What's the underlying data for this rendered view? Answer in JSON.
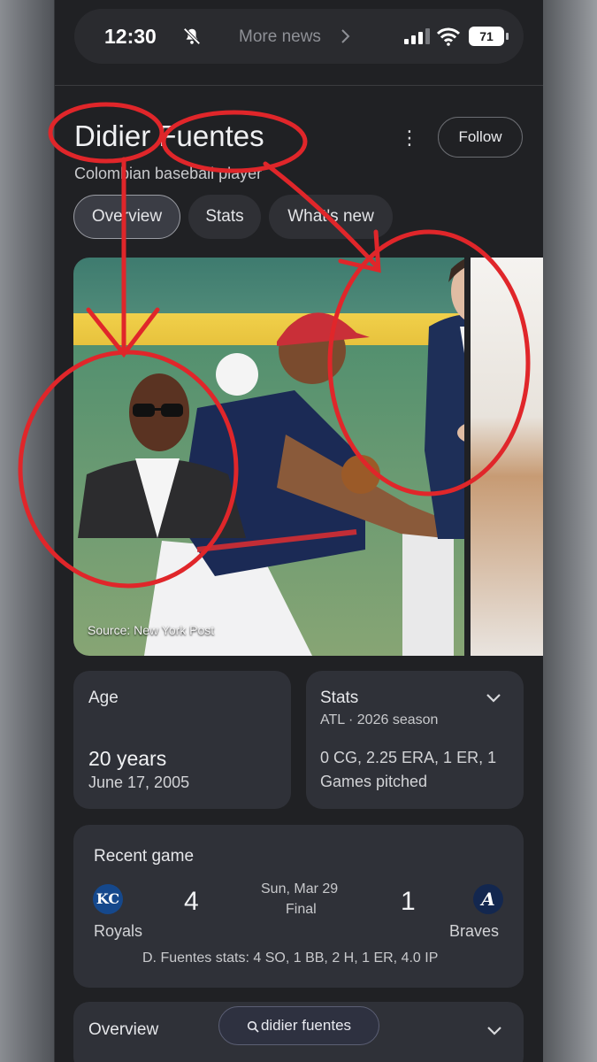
{
  "status": {
    "time": "12:30",
    "center_text": "More news",
    "battery": "71"
  },
  "header": {
    "title": "Didier Fuentes",
    "subtitle": "Colombian baseball player",
    "follow_label": "Follow"
  },
  "tabs": [
    {
      "label": "Overview",
      "active": true
    },
    {
      "label": "Stats",
      "active": false
    },
    {
      "label": "What's new",
      "active": false
    }
  ],
  "hero": {
    "source": "Source: New York Post"
  },
  "age_card": {
    "label": "Age",
    "value": "20 years",
    "date": "June 17, 2005"
  },
  "stats_card": {
    "label": "Stats",
    "season": "ATL · 2026 season",
    "line1": "0 CG, 2.25 ERA, 1 ER, 1",
    "line2": "Games pitched"
  },
  "recent_game": {
    "label": "Recent game",
    "home_team": "Royals",
    "home_logo": "KC",
    "home_score": "4",
    "away_team": "Braves",
    "away_logo": "A",
    "away_score": "1",
    "date": "Sun, Mar 29",
    "status": "Final",
    "player_stats": "D. Fuentes stats: 4 SO, 1 BB, 2 H, 1 ER, 4.0 IP"
  },
  "overview_card": {
    "label": "Overview"
  },
  "search_pill": {
    "query": "didier fuentes"
  },
  "colors": {
    "annotation_red": "#e0262a",
    "background": "#202124",
    "card": "#2f3138"
  }
}
